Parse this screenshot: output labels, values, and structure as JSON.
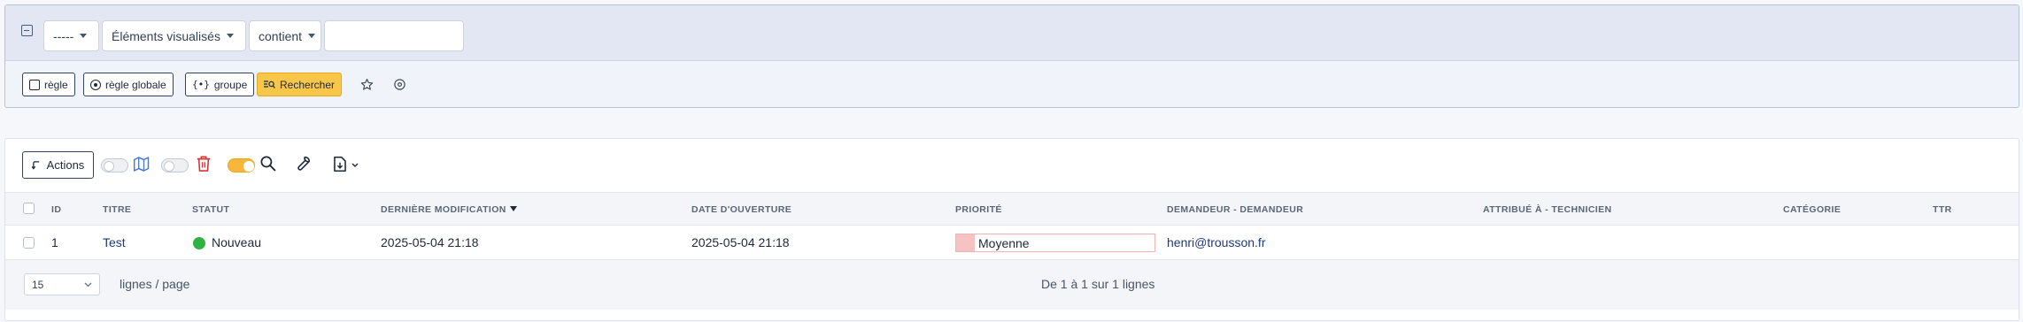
{
  "search": {
    "field_placeholder": "-----",
    "criteria_field": "Éléments visualisés",
    "operator": "contient",
    "value": "",
    "buttons": {
      "rule": "règle",
      "global_rule": "règle globale",
      "group": "groupe",
      "search": "Rechercher"
    }
  },
  "toolbar": {
    "actions_label": "Actions"
  },
  "table": {
    "columns": [
      "ID",
      "TITRE",
      "STATUT",
      "DERNIÈRE MODIFICATION",
      "DATE D'OUVERTURE",
      "PRIORITÉ",
      "DEMANDEUR - DEMANDEUR",
      "ATTRIBUÉ À - TECHNICIEN",
      "CATÉGORIE",
      "TTR"
    ],
    "rows": [
      {
        "id": "1",
        "title": "Test",
        "status": "Nouveau",
        "last_modified": "2025-05-04 21:18",
        "opened": "2025-05-04 21:18",
        "priority": "Moyenne",
        "requester": "henri@trousson.fr",
        "technician": "",
        "category": "",
        "ttr": ""
      }
    ]
  },
  "pagination": {
    "page_size": "15",
    "per_page_label": "lignes / page",
    "summary": "De 1 à 1 sur 1 lignes"
  },
  "colors": {
    "primary_button": "#f8c74a",
    "status_new": "#2fb344",
    "priority_medium": "#f7c2c2",
    "link": "#1f3a7a"
  }
}
